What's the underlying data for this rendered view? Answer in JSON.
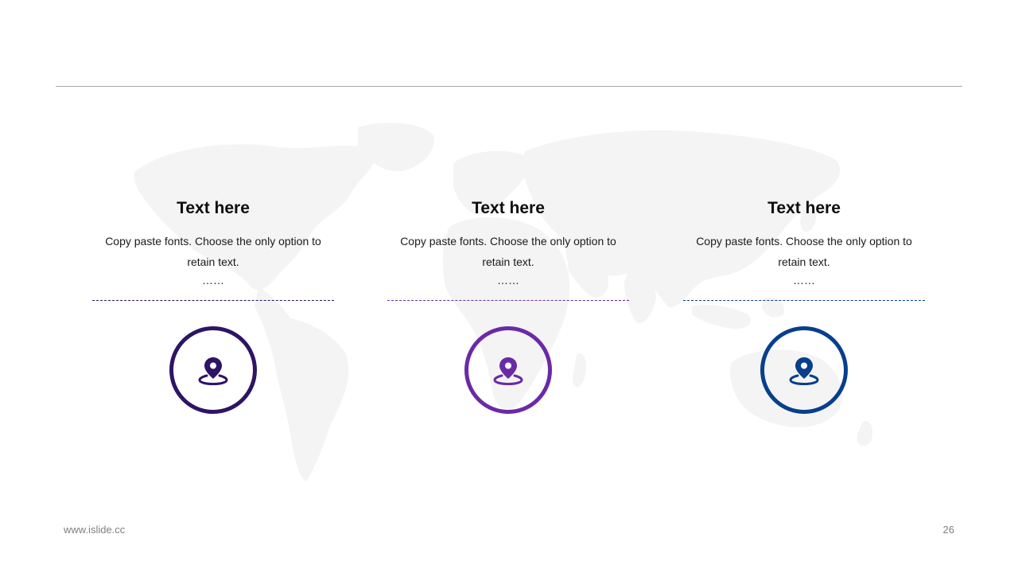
{
  "columns": [
    {
      "title": "Text here",
      "body": "Copy paste fonts. Choose the only option to retain text.",
      "dots": "……",
      "icon": "map-pin-icon",
      "color": "#2e1465"
    },
    {
      "title": "Text here",
      "body": "Copy paste fonts. Choose the only option to retain text.",
      "dots": "……",
      "icon": "map-pin-icon",
      "color": "#6a2aa6"
    },
    {
      "title": "Text here",
      "body": "Copy paste fonts. Choose the only option to retain text.",
      "dots": "……",
      "icon": "map-pin-icon",
      "color": "#073f8c"
    }
  ],
  "footer": {
    "website": "www.islide.cc",
    "page_number": "26"
  },
  "colors": {
    "rule": "#a6a6a6",
    "map": "#f3f3f3",
    "footer_text": "#7f7f7f"
  }
}
